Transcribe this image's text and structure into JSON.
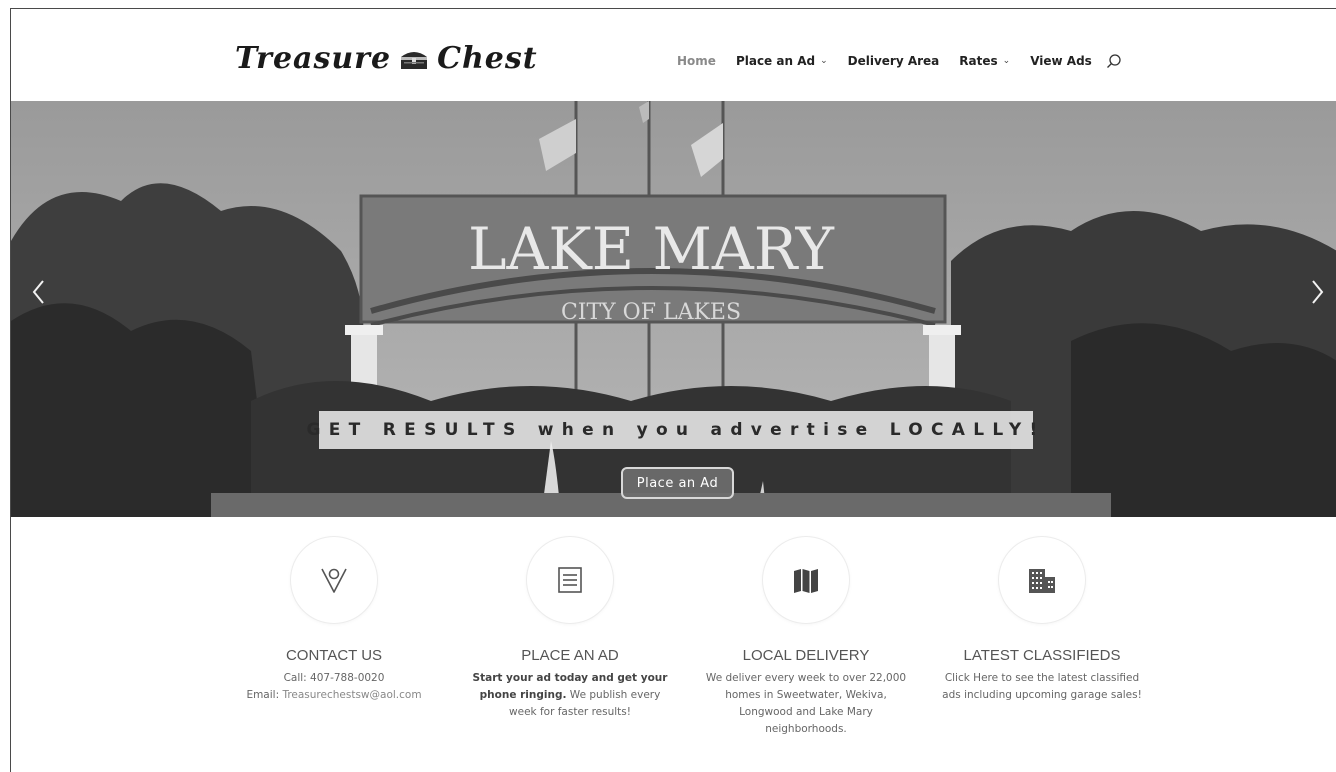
{
  "header": {
    "logo_left": "Treasure",
    "logo_right": "Chest",
    "nav": [
      {
        "label": "Home",
        "active": true,
        "dropdown": false
      },
      {
        "label": "Place an Ad",
        "active": false,
        "dropdown": true
      },
      {
        "label": "Delivery Area",
        "active": false,
        "dropdown": false
      },
      {
        "label": "Rates",
        "active": false,
        "dropdown": true
      },
      {
        "label": "View Ads",
        "active": false,
        "dropdown": false
      }
    ],
    "search_icon": "search-icon"
  },
  "hero": {
    "sign_main": "LAKE MARY",
    "sign_sub": "CITY OF LAKES",
    "tagline": "GET RESULTS when you advertise LOCALLY!",
    "button_label": "Place an Ad",
    "prev_icon": "chevron-left-icon",
    "next_icon": "chevron-right-icon"
  },
  "features": [
    {
      "icon": "map-pin-icon",
      "title": "CONTACT US",
      "line1": "Call: 407-788-0020",
      "line2_prefix": "Email: ",
      "email": "Treasurechestsw@aol.com"
    },
    {
      "icon": "list-document-icon",
      "title": "PLACE AN AD",
      "bold": "Start your ad today and get your phone ringing.",
      "text": " We publish every week for faster results!"
    },
    {
      "icon": "map-icon",
      "title": "LOCAL DELIVERY",
      "text": "We deliver every week to over 22,000 homes in Sweetwater, Wekiva, Longwood and Lake Mary neighborhoods."
    },
    {
      "icon": "building-icon",
      "title": "LATEST CLASSIFIEDS",
      "text": "Click Here to see the latest classified ads including upcoming garage sales!"
    }
  ],
  "colors": {
    "nav_active": "#8a8a8a",
    "text_dark": "#222222",
    "hero_button": "#6e6e6e"
  }
}
